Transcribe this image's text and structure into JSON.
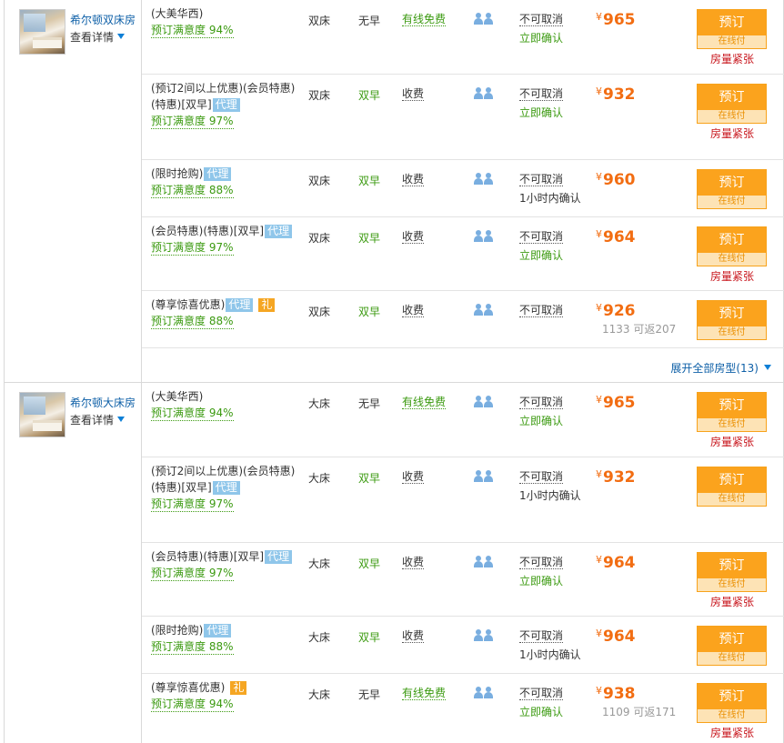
{
  "groups": [
    {
      "room_name": "希尔顿双床房",
      "detail_label": "查看详情",
      "expand_label": "展开全部房型(13)",
      "rows": [
        {
          "name": "(大美华西)",
          "agent": "",
          "gift": "",
          "satisfaction": "预订满意度 94%",
          "bed": "双床",
          "meal": "无早",
          "meal_green": false,
          "net": "有线免费",
          "net_green": true,
          "cancel": "不可取消",
          "confirm": "立即确认",
          "confirm_green": true,
          "currency": "¥",
          "price": "965",
          "cashback": "",
          "book": "预订",
          "pay": "在线付",
          "tight": "房量紧张"
        },
        {
          "name": "(预订2间以上优惠)(会员特惠)(特惠)[双早]",
          "agent": "代理",
          "gift": "",
          "satisfaction": "预订满意度 97%",
          "bed": "双床",
          "meal": "双早",
          "meal_green": true,
          "net": "收费",
          "net_green": false,
          "cancel": "不可取消",
          "confirm": "立即确认",
          "confirm_green": true,
          "currency": "¥",
          "price": "932",
          "cashback": "",
          "book": "预订",
          "pay": "在线付",
          "tight": "房量紧张"
        },
        {
          "name": "(限时抢购)",
          "agent": "代理",
          "gift": "",
          "satisfaction": "预订满意度 88%",
          "bed": "双床",
          "meal": "双早",
          "meal_green": true,
          "net": "收费",
          "net_green": false,
          "cancel": "不可取消",
          "confirm": "1小时内确认",
          "confirm_green": false,
          "currency": "¥",
          "price": "960",
          "cashback": "",
          "book": "预订",
          "pay": "在线付",
          "tight": ""
        },
        {
          "name": "(会员特惠)(特惠)[双早]",
          "agent": "代理",
          "gift": "",
          "satisfaction": "预订满意度 97%",
          "bed": "双床",
          "meal": "双早",
          "meal_green": true,
          "net": "收费",
          "net_green": false,
          "cancel": "不可取消",
          "confirm": "立即确认",
          "confirm_green": true,
          "currency": "¥",
          "price": "964",
          "cashback": "",
          "book": "预订",
          "pay": "在线付",
          "tight": "房量紧张"
        },
        {
          "name": "(尊享惊喜优惠)",
          "agent": "代理",
          "gift": "礼",
          "satisfaction": "预订满意度 88%",
          "bed": "双床",
          "meal": "双早",
          "meal_green": true,
          "net": "收费",
          "net_green": false,
          "cancel": "不可取消",
          "confirm": "",
          "confirm_green": false,
          "currency": "¥",
          "price": "926",
          "cashback": "1133 可返207",
          "book": "预订",
          "pay": "在线付",
          "tight": ""
        }
      ]
    },
    {
      "room_name": "希尔顿大床房",
      "detail_label": "查看详情",
      "expand_label": "",
      "rows": [
        {
          "name": "(大美华西)",
          "agent": "",
          "gift": "",
          "satisfaction": "预订满意度 94%",
          "bed": "大床",
          "meal": "无早",
          "meal_green": false,
          "net": "有线免费",
          "net_green": true,
          "cancel": "不可取消",
          "confirm": "立即确认",
          "confirm_green": true,
          "currency": "¥",
          "price": "965",
          "cashback": "",
          "book": "预订",
          "pay": "在线付",
          "tight": "房量紧张"
        },
        {
          "name": "(预订2间以上优惠)(会员特惠)(特惠)[双早]",
          "agent": "代理",
          "gift": "",
          "satisfaction": "预订满意度 97%",
          "bed": "大床",
          "meal": "双早",
          "meal_green": true,
          "net": "收费",
          "net_green": false,
          "cancel": "不可取消",
          "confirm": "1小时内确认",
          "confirm_green": false,
          "currency": "¥",
          "price": "932",
          "cashback": "",
          "book": "预订",
          "pay": "在线付",
          "tight": ""
        },
        {
          "name": "(会员特惠)(特惠)[双早]",
          "agent": "代理",
          "gift": "",
          "satisfaction": "预订满意度 97%",
          "bed": "大床",
          "meal": "双早",
          "meal_green": true,
          "net": "收费",
          "net_green": false,
          "cancel": "不可取消",
          "confirm": "立即确认",
          "confirm_green": true,
          "currency": "¥",
          "price": "964",
          "cashback": "",
          "book": "预订",
          "pay": "在线付",
          "tight": "房量紧张"
        },
        {
          "name": "(限时抢购)",
          "agent": "代理",
          "gift": "",
          "satisfaction": "预订满意度 88%",
          "bed": "大床",
          "meal": "双早",
          "meal_green": true,
          "net": "收费",
          "net_green": false,
          "cancel": "不可取消",
          "confirm": "1小时内确认",
          "confirm_green": false,
          "currency": "¥",
          "price": "964",
          "cashback": "",
          "book": "预订",
          "pay": "在线付",
          "tight": ""
        },
        {
          "name": "(尊享惊喜优惠)",
          "agent": "",
          "gift": "礼",
          "satisfaction": "预订满意度 94%",
          "bed": "大床",
          "meal": "无早",
          "meal_green": false,
          "net": "有线免费",
          "net_green": true,
          "cancel": "不可取消",
          "confirm": "立即确认",
          "confirm_green": true,
          "currency": "¥",
          "price": "938",
          "cashback": "1109 可返171",
          "book": "预订",
          "pay": "在线付",
          "tight": "房量紧张"
        }
      ]
    }
  ]
}
